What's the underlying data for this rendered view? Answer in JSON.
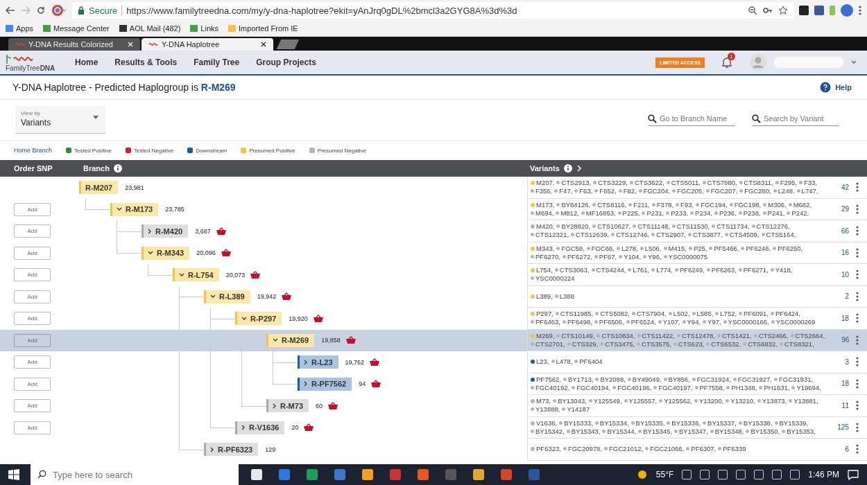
{
  "browser": {
    "tabs": [
      {
        "title": "Y-DNA Results Colorized",
        "selected": false
      },
      {
        "title": "Y-DNA Haplotree",
        "selected": true
      }
    ],
    "secure_label": "Secure",
    "url": "https://www.familytreedna.com/my/y-dna-haplotree?ekit=yAnJrq0gDL%2bmcl3a2GYG8A%3d%3d",
    "bookmarks": [
      "Apps",
      "Message Center",
      "AOL Mail (482)",
      "Links",
      "Imported From IE"
    ]
  },
  "site": {
    "logo_text": "FamilyTree",
    "logo_bold": "DNA",
    "nav": [
      "Home",
      "Results & Tools",
      "Family Tree",
      "Group Projects"
    ],
    "access_badge": "LIMITED ACCESS",
    "notification_count": "1"
  },
  "page": {
    "title": "Y-DNA Haplotree - Predicted Haplogroup is ",
    "haplogroup": "R-M269",
    "help": "Help"
  },
  "view_by": {
    "label": "View by",
    "value": "Variants"
  },
  "search": [
    {
      "placeholder": "Go to Branch Name"
    },
    {
      "placeholder": "Search by Variant"
    }
  ],
  "legend": {
    "home_link": "Home Branch",
    "items": [
      {
        "label": "Tested Positive",
        "color": "#2e8b3e"
      },
      {
        "label": "Tested Negative",
        "color": "#d0202a"
      },
      {
        "label": "Downstream",
        "color": "#1f5b99"
      },
      {
        "label": "Presumed Positive",
        "color": "#f2c53d"
      },
      {
        "label": "Presumed Negative",
        "color": "#b5b5b5"
      }
    ]
  },
  "table": {
    "columns": [
      "Order SNP",
      "Branch",
      "Variants"
    ],
    "tree": [
      {
        "label": "R-M207",
        "count": "23,981",
        "kind": "presumed_positive",
        "basket": false,
        "selected": false,
        "variants": {
          "color": "#f2c53d",
          "total": "42",
          "lines": [
            [
              "M207,",
              "CTS2913,",
              "CTS3229,",
              "CTS3622,",
              "CTS5011,",
              "CTS7880,",
              "CTS8311,",
              "F295,",
              "F33,"
            ],
            [
              "F356,",
              "F47,",
              "F63,",
              "F652,",
              "F82,",
              "FGC204,",
              "FGC205,",
              "FGC207,",
              "FGC280,",
              "L248,",
              "L747,"
            ]
          ]
        },
        "children": [
          {
            "label": "R-M173",
            "count": "23,785",
            "kind": "presumed_positive",
            "expanded": true,
            "basket": false,
            "selected": false,
            "order_button": "Add",
            "variants": {
              "color": "#f2c53d",
              "total": "29",
              "lines": [
                [
                  "M173,",
                  "BY84126,",
                  "CTS8116,",
                  "F211,",
                  "F378,",
                  "F93,",
                  "FGC194,",
                  "FGC198,",
                  "M306,",
                  "M682,"
                ],
                [
                  "M694,",
                  "M812,",
                  "MF16853,",
                  "P225,",
                  "P231,",
                  "P233,",
                  "P234,",
                  "P236,",
                  "P238,",
                  "P241,",
                  "P242,"
                ]
              ]
            },
            "children": [
              {
                "label": "R-M420",
                "count": "3,687",
                "kind": "presumed_negative",
                "expanded": false,
                "basket": true,
                "selected": false,
                "order_button": "Add",
                "variants": {
                  "color": "#b5b5b5",
                  "total": "66",
                  "lines": [
                    [
                      "M420,",
                      "BY28820,",
                      "CTS10627,",
                      "CTS11148,",
                      "CTS11530,",
                      "CTS11734,",
                      "CTS12276,"
                    ],
                    [
                      "CTS12321,",
                      "CTS12639,",
                      "CTS12746,",
                      "CTS2907,",
                      "CTS3877,",
                      "CTS4509,",
                      "CTS5164,"
                    ]
                  ]
                }
              },
              {
                "label": "R-M343",
                "count": "20,096",
                "kind": "presumed_positive",
                "expanded": true,
                "basket": true,
                "selected": false,
                "order_button": "Add",
                "variants": {
                  "color": "#f2c53d",
                  "total": "16",
                  "lines": [
                    [
                      "M343,",
                      "FGC58,",
                      "FGC66,",
                      "L278,",
                      "L506,",
                      "M415,",
                      "P25,",
                      "PF5466,",
                      "PF6246,",
                      "PF6250,"
                    ],
                    [
                      "PF6270,",
                      "PF6272,",
                      "PF67,",
                      "Y104,",
                      "Y96,",
                      "YSC0000075"
                    ]
                  ]
                },
                "children": [
                  {
                    "label": "R-L754",
                    "count": "20,073",
                    "kind": "presumed_positive",
                    "expanded": true,
                    "basket": true,
                    "selected": false,
                    "order_button": "Add",
                    "variants": {
                      "color": "#f2c53d",
                      "total": "10",
                      "lines": [
                        [
                          "L754,",
                          "CTS3063,",
                          "CTS4244,",
                          "L761,",
                          "L774,",
                          "PF6249,",
                          "PF6263,",
                          "PF6271,",
                          "Y418,"
                        ],
                        [
                          "YSC0000224"
                        ]
                      ]
                    },
                    "children": [
                      {
                        "label": "R-L389",
                        "count": "19,942",
                        "kind": "presumed_positive",
                        "expanded": true,
                        "basket": true,
                        "selected": false,
                        "order_button": "Add",
                        "variants": {
                          "color": "#f2c53d",
                          "total": "2",
                          "lines": [
                            [
                              "L389,",
                              "L388"
                            ]
                          ]
                        },
                        "children": [
                          {
                            "label": "R-P297",
                            "count": "19,920",
                            "kind": "presumed_positive",
                            "expanded": true,
                            "basket": true,
                            "selected": false,
                            "order_button": "Add",
                            "variants": {
                              "color": "#f2c53d",
                              "total": "18",
                              "lines": [
                                [
                                  "P297,",
                                  "CTS11985,",
                                  "CTS5082,",
                                  "CTS7904,",
                                  "L502,",
                                  "L585,",
                                  "L752,",
                                  "PF6091,",
                                  "PF6424,"
                                ],
                                [
                                  "PF6463,",
                                  "PF6498,",
                                  "PF6506,",
                                  "PF6524,",
                                  "Y107,",
                                  "Y94,",
                                  "Y97,",
                                  "YSC0000166,",
                                  "YSC0000269"
                                ]
                              ]
                            },
                            "children": [
                              {
                                "label": "R-M269",
                                "count": "19,858",
                                "kind": "presumed_positive",
                                "expanded": true,
                                "basket": true,
                                "selected": true,
                                "order_button": "Add",
                                "variants": {
                                  "color": "#f2c53d",
                                  "total": "96",
                                  "lines": [
                                    [
                                      "M269,",
                                      "CTS10149,",
                                      "CTS10834,",
                                      "CTS11422,",
                                      "CTS12478,",
                                      "CTS1421,",
                                      "CTS2466,",
                                      "CTS2664,"
                                    ],
                                    [
                                      "CTS2701,",
                                      "CTS329,",
                                      "CTS3475,",
                                      "CTS3575,",
                                      "CTS623,",
                                      "CTS6532,",
                                      "CTS6832,",
                                      "CTS8321,"
                                    ]
                                  ]
                                },
                                "children": [
                                  {
                                    "label": "R-L23",
                                    "count": "19,762",
                                    "kind": "downstream",
                                    "expanded": false,
                                    "basket": true,
                                    "selected": false,
                                    "order_button": "Add",
                                    "variants": {
                                      "color": "#1f5b99",
                                      "total": "3",
                                      "lines": [
                                        [
                                          "L23,",
                                          "L478,",
                                          "PF6404"
                                        ]
                                      ]
                                    }
                                  },
                                  {
                                    "label": "R-PF7562",
                                    "count": "94",
                                    "kind": "downstream",
                                    "expanded": false,
                                    "basket": true,
                                    "selected": false,
                                    "order_button": "Add",
                                    "variants": {
                                      "color": "#1f5b99",
                                      "total": "18",
                                      "lines": [
                                        [
                                          "PF7562,",
                                          "BY1713,",
                                          "BY2098,",
                                          "BY49049,",
                                          "BY856,",
                                          "FGC31924,",
                                          "FGC31927,",
                                          "FGC31931,"
                                        ],
                                        [
                                          "FGC40192,",
                                          "FGC40194,",
                                          "FGC40196,",
                                          "FGC40197,",
                                          "PF7558,",
                                          "PH1348,",
                                          "PH1631,",
                                          "Y19694,"
                                        ]
                                      ]
                                    }
                                  }
                                ]
                              },
                              {
                                "label": "R-M73",
                                "count": "60",
                                "kind": "presumed_negative",
                                "expanded": false,
                                "basket": true,
                                "selected": false,
                                "order_button": "Add",
                                "variants": {
                                  "color": "#b5b5b5",
                                  "total": "11",
                                  "lines": [
                                    [
                                      "M73,",
                                      "BY13043,",
                                      "Y125549,",
                                      "Y125557,",
                                      "Y125562,",
                                      "Y13200,",
                                      "Y13210,",
                                      "Y13873,",
                                      "Y13881,"
                                    ],
                                    [
                                      "Y13888,",
                                      "Y14187"
                                    ]
                                  ]
                                }
                              }
                            ]
                          },
                          {
                            "label": "R-V1636",
                            "count": "20",
                            "kind": "presumed_negative",
                            "expanded": false,
                            "basket": true,
                            "selected": false,
                            "order_button": "Add",
                            "variants": {
                              "color": "#b5b5b5",
                              "total": "125",
                              "lines": [
                                [
                                  "V1636,",
                                  "BY15333,",
                                  "BY15334,",
                                  "BY15335,",
                                  "BY15336,",
                                  "BY15337,",
                                  "BY15338,",
                                  "BY15339,"
                                ],
                                [
                                  "BY15342,",
                                  "BY15343,",
                                  "BY15344,",
                                  "BY15345,",
                                  "BY15347,",
                                  "BY15348,",
                                  "BY15350,",
                                  "BY15353,"
                                ]
                              ]
                            }
                          }
                        ]
                      },
                      {
                        "label": "R-PF6323",
                        "count": "129",
                        "kind": "presumed_negative",
                        "expanded": false,
                        "basket": false,
                        "selected": false,
                        "variants": {
                          "color": "#b5b5b5",
                          "total": "6",
                          "lines": [
                            [
                              "PF6323,",
                              "FGC20978,",
                              "FGC21012,",
                              "FGC21066,",
                              "PF6307,",
                              "PF6339"
                            ]
                          ]
                        }
                      }
                    ]
                  }
                ]
              }
            ]
          }
        ]
      }
    ]
  },
  "taskbar": {
    "search_placeholder": "Type here to search",
    "weather": "55°F",
    "time": "1:46 PM"
  }
}
